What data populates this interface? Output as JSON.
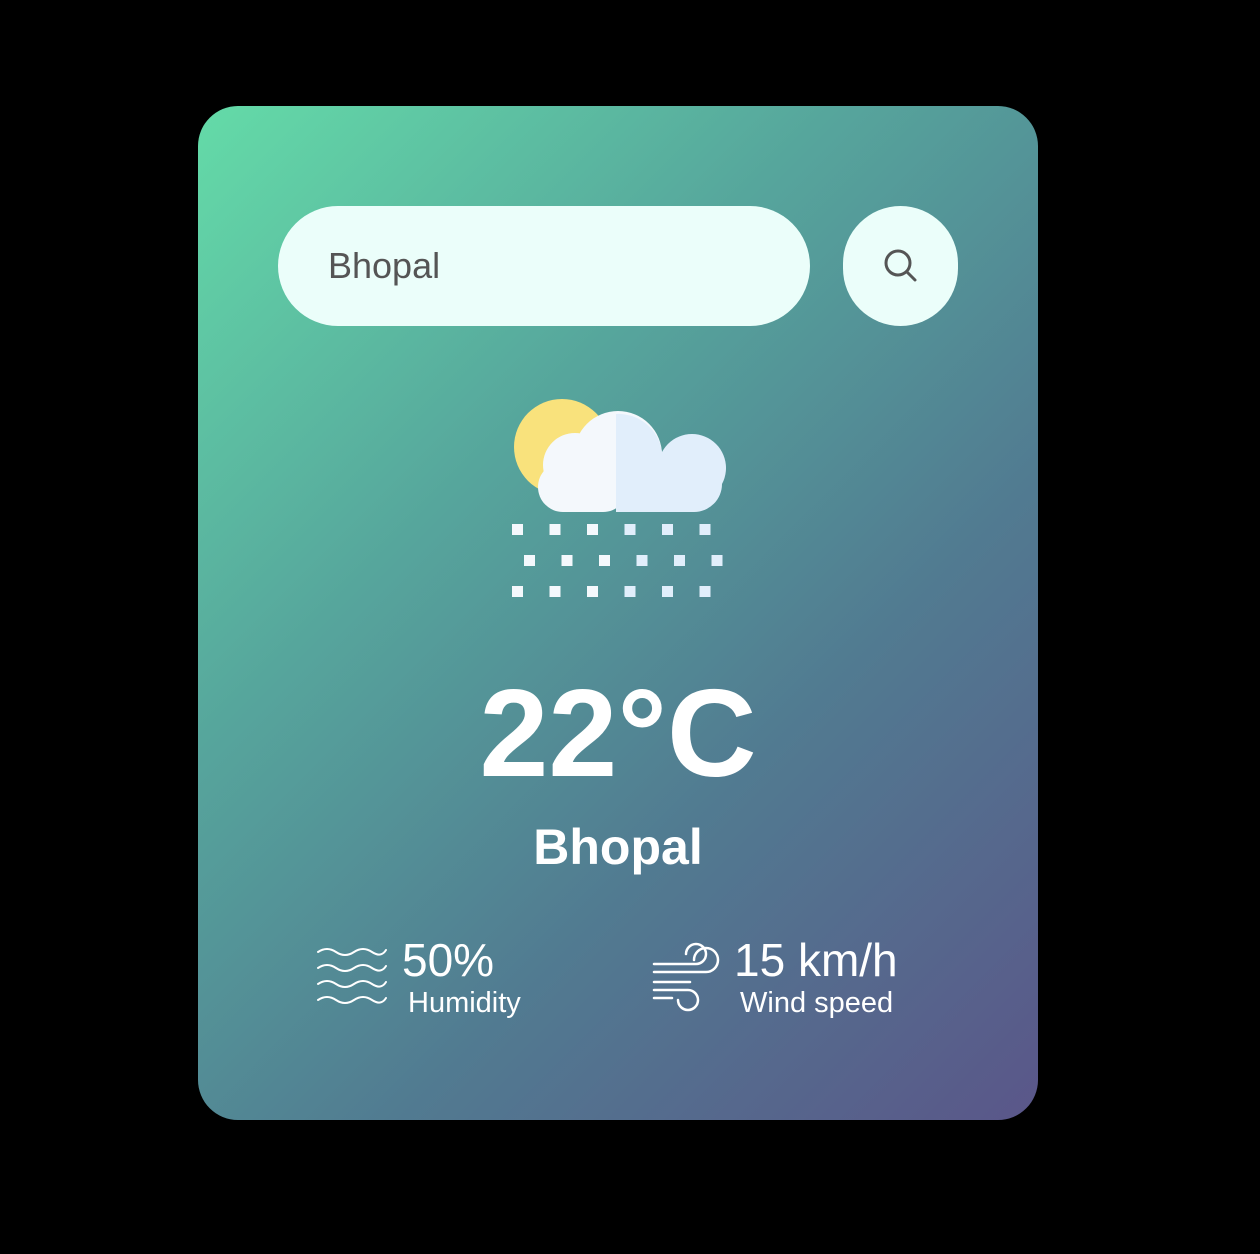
{
  "search": {
    "value": "Bhopal",
    "icon": "search-icon"
  },
  "weather": {
    "icon": "snow-cloud-sun-icon",
    "temperature": "22°C",
    "city": "Bhopal"
  },
  "humidity": {
    "icon": "humidity-waves-icon",
    "value": "50%",
    "label": "Humidity"
  },
  "wind": {
    "icon": "wind-icon",
    "value": "15 km/h",
    "label": "Wind speed"
  },
  "colors": {
    "page_background": "#000000",
    "card_gradient_start": "#64dba8",
    "card_gradient_end": "#5a5689",
    "search_background": "#ebfefa",
    "text": "#ffffff"
  }
}
